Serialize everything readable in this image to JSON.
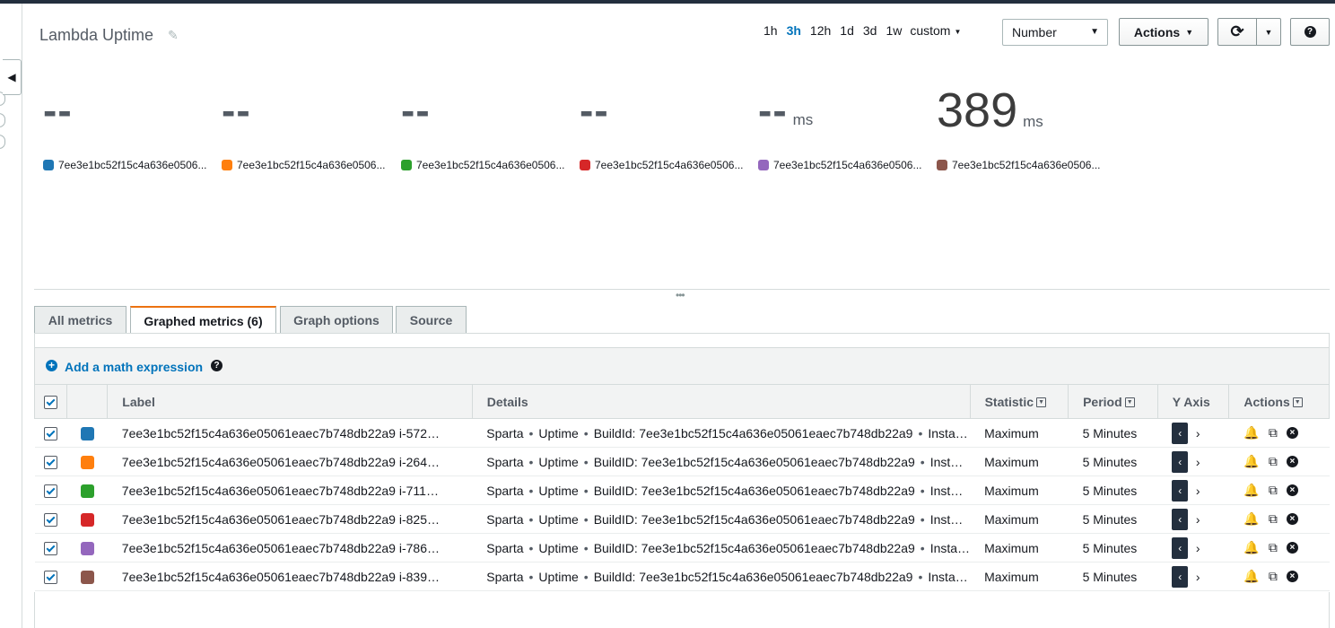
{
  "dashboard": {
    "title": "Lambda Uptime"
  },
  "time_ranges": [
    "1h",
    "3h",
    "12h",
    "1d",
    "3d",
    "1w"
  ],
  "time_range_active": "3h",
  "time_custom_label": "custom",
  "view_select": {
    "value": "Number"
  },
  "actions_label": "Actions",
  "stats": [
    {
      "value": "--",
      "unit": "",
      "color": "#1f77b4",
      "legend": "7ee3e1bc52f15c4a636e0506..."
    },
    {
      "value": "--",
      "unit": "",
      "color": "#ff7f0e",
      "legend": "7ee3e1bc52f15c4a636e0506..."
    },
    {
      "value": "--",
      "unit": "",
      "color": "#2ca02c",
      "legend": "7ee3e1bc52f15c4a636e0506..."
    },
    {
      "value": "--",
      "unit": "",
      "color": "#d62728",
      "legend": "7ee3e1bc52f15c4a636e0506..."
    },
    {
      "value": "--",
      "unit": "ms",
      "color": "#9467bd",
      "legend": "7ee3e1bc52f15c4a636e0506..."
    },
    {
      "value": "389",
      "unit": "ms",
      "color": "#8c564b",
      "legend": "7ee3e1bc52f15c4a636e0506..."
    }
  ],
  "tabs": [
    {
      "label": "All metrics",
      "active": false
    },
    {
      "label": "Graphed metrics (6)",
      "active": true
    },
    {
      "label": "Graph options",
      "active": false
    },
    {
      "label": "Source",
      "active": false
    }
  ],
  "math_expression_label": "Add a math expression",
  "table": {
    "headers": {
      "label": "Label",
      "details": "Details",
      "statistic": "Statistic",
      "period": "Period",
      "yaxis": "Y Axis",
      "actions": "Actions"
    },
    "rows": [
      {
        "color": "#1f77b4",
        "label": "7ee3e1bc52f15c4a636e05061eaec7b748db22a9 i-572…",
        "details_ns": "Sparta",
        "details_metric": "Uptime",
        "details_build": "BuildId: 7ee3e1bc52f15c4a636e05061eaec7b748db22a9",
        "details_tail": "Insta…",
        "statistic": "Maximum",
        "period": "5 Minutes"
      },
      {
        "color": "#ff7f0e",
        "label": "7ee3e1bc52f15c4a636e05061eaec7b748db22a9 i-264…",
        "details_ns": "Sparta",
        "details_metric": "Uptime",
        "details_build": "BuildID: 7ee3e1bc52f15c4a636e05061eaec7b748db22a9",
        "details_tail": "Inst…",
        "statistic": "Maximum",
        "period": "5 Minutes"
      },
      {
        "color": "#2ca02c",
        "label": "7ee3e1bc52f15c4a636e05061eaec7b748db22a9 i-711…",
        "details_ns": "Sparta",
        "details_metric": "Uptime",
        "details_build": "BuildID: 7ee3e1bc52f15c4a636e05061eaec7b748db22a9",
        "details_tail": "Inst…",
        "statistic": "Maximum",
        "period": "5 Minutes"
      },
      {
        "color": "#d62728",
        "label": "7ee3e1bc52f15c4a636e05061eaec7b748db22a9 i-825…",
        "details_ns": "Sparta",
        "details_metric": "Uptime",
        "details_build": "BuildID: 7ee3e1bc52f15c4a636e05061eaec7b748db22a9",
        "details_tail": "Inst…",
        "statistic": "Maximum",
        "period": "5 Minutes"
      },
      {
        "color": "#9467bd",
        "label": "7ee3e1bc52f15c4a636e05061eaec7b748db22a9 i-786…",
        "details_ns": "Sparta",
        "details_metric": "Uptime",
        "details_build": "BuildID: 7ee3e1bc52f15c4a636e05061eaec7b748db22a9",
        "details_tail": "Insta…",
        "statistic": "Maximum",
        "period": "5 Minutes"
      },
      {
        "color": "#8c564b",
        "label": "7ee3e1bc52f15c4a636e05061eaec7b748db22a9 i-839…",
        "details_ns": "Sparta",
        "details_metric": "Uptime",
        "details_build": "BuildId: 7ee3e1bc52f15c4a636e05061eaec7b748db22a9",
        "details_tail": "Insta…",
        "statistic": "Maximum",
        "period": "5 Minutes"
      }
    ]
  }
}
